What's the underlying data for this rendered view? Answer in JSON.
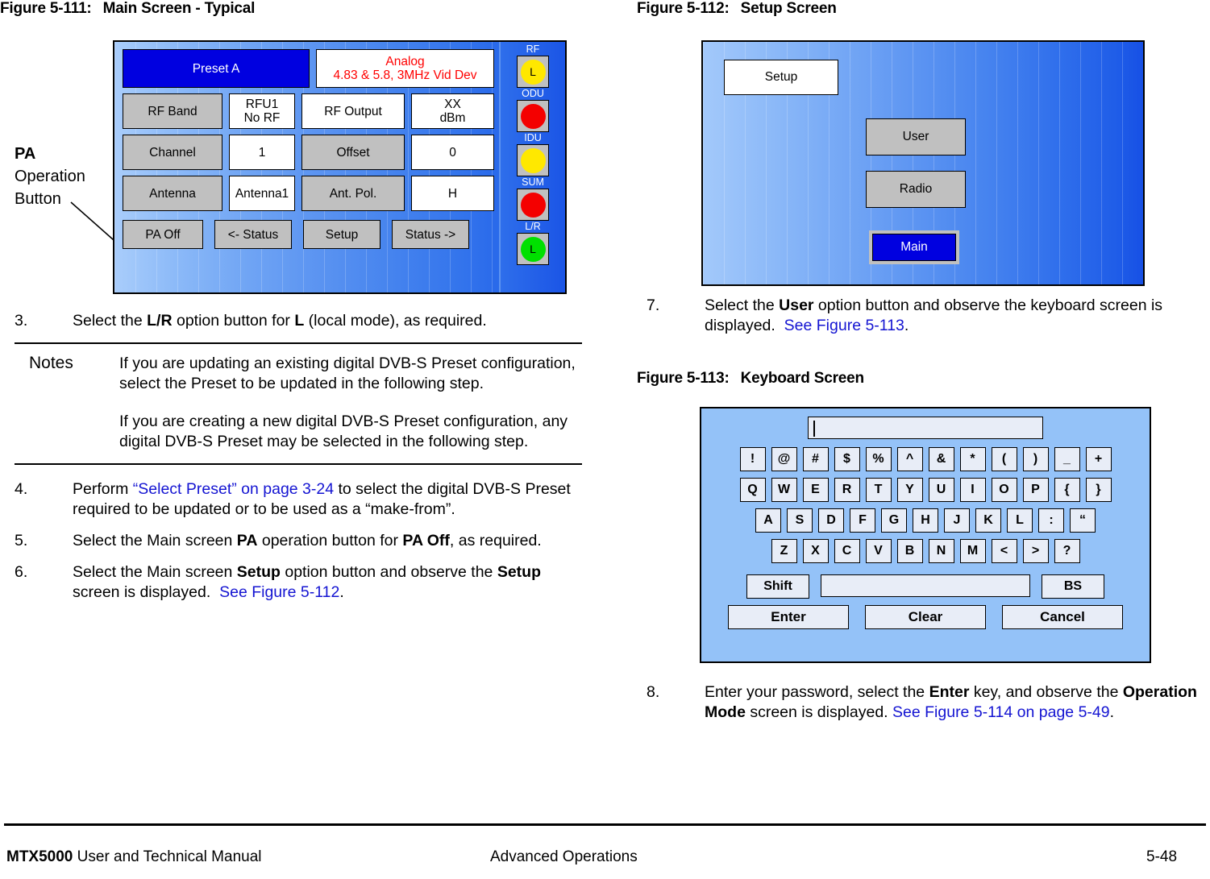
{
  "figures": {
    "fig111": {
      "num": "Figure 5-111:",
      "title": "Main Screen - Typical"
    },
    "fig112": {
      "num": "Figure 5-112:",
      "title": "Setup Screen"
    },
    "fig113": {
      "num": "Figure 5-113:",
      "title": "Keyboard Screen"
    }
  },
  "annotation": {
    "line1": "PA",
    "line2": "Operation",
    "line3": "Button"
  },
  "main_screen": {
    "preset": "Preset A",
    "mode_line1": "Analog",
    "mode_line2": "4.83 & 5.8, 3MHz Vid Dev",
    "rows": [
      {
        "label": "RF Band",
        "value_line1": "RFU1",
        "value_line2": "No RF",
        "label2": "RF Output",
        "value2_line1": "XX",
        "value2_line2": "dBm"
      },
      {
        "label": "Channel",
        "value_line1": "1",
        "value_line2": "",
        "label2": "Offset",
        "value2_line1": "0",
        "value2_line2": ""
      },
      {
        "label": "Antenna",
        "value_line1": "Antenna1",
        "value_line2": "",
        "label2": "Ant. Pol.",
        "value2_line1": "H",
        "value2_line2": ""
      }
    ],
    "bottom_buttons": [
      "PA Off",
      "<- Status",
      "Setup",
      "Status ->"
    ],
    "indicators": [
      {
        "name": "RF",
        "color": "#ffe800",
        "text": "L"
      },
      {
        "name": "ODU",
        "color": "#f40000",
        "text": ""
      },
      {
        "name": "IDU",
        "color": "#ffe800",
        "text": ""
      },
      {
        "name": "SUM",
        "color": "#f40000",
        "text": ""
      },
      {
        "name": "L/R",
        "color": "#00e000",
        "text": "L"
      }
    ]
  },
  "setup_screen": {
    "title_button": "Setup",
    "user_button": "User",
    "radio_button": "Radio",
    "main_button": "Main"
  },
  "keyboard_screen": {
    "input_value": "",
    "row_symbols": [
      "!",
      "@",
      "#",
      "$",
      "%",
      "^",
      "&",
      "*",
      "(",
      ")",
      "_",
      "+"
    ],
    "row_qwerty": [
      "Q",
      "W",
      "E",
      "R",
      "T",
      "Y",
      "U",
      "I",
      "O",
      "P",
      "{",
      "}"
    ],
    "row_asdf": [
      "A",
      "S",
      "D",
      "F",
      "G",
      "H",
      "J",
      "K",
      "L",
      ":",
      "“"
    ],
    "row_zxcv": [
      "Z",
      "X",
      "C",
      "V",
      "B",
      "N",
      "M",
      "<",
      ">",
      "?"
    ],
    "shift_key": "Shift",
    "space_key": "",
    "bs_key": "BS",
    "enter_key": "Enter",
    "clear_key": "Clear",
    "cancel_key": "Cancel"
  },
  "steps": {
    "s3": {
      "num": "3.",
      "html": "Select the <b>L/R</b> option button for <b>L</b> (local mode), as required."
    },
    "s4": {
      "num": "4.",
      "html": "Perform <span class=\"lnk\">&ldquo;Select Preset&rdquo; on page 3-24</span> to select the digital DVB-S Preset required to be updated or to be used as a &ldquo;make-from&rdquo;."
    },
    "s5": {
      "num": "5.",
      "html": "Select the Main screen <b>PA</b> operation button for <b>PA Off</b>, as required."
    },
    "s6": {
      "num": "6.",
      "html": "Select the Main screen <b>Setup</b> option button and observe the <b>Setup</b> screen is displayed.&nbsp; <span class=\"lnk\">See Figure 5-112</span>."
    },
    "s7": {
      "num": "7.",
      "html": "Select the <b>User</b> option button and observe the keyboard screen is displayed.&nbsp; <span class=\"lnk\">See Figure 5-113</span>."
    },
    "s8": {
      "num": "8.",
      "html": "Enter your password, select the <b>Enter</b> key, and observe the <b>Operation Mode</b> screen is displayed. <span class=\"lnk\">See Figure 5-114 on page 5-49</span>."
    }
  },
  "notes": {
    "label": "Notes",
    "p1": "If you are updating an existing digital DVB-S Preset configuration, select the Preset to be updated in the following step.",
    "p2": "If you are creating a new digital DVB-S Preset configuration, any digital DVB-S Preset may be selected in the following step."
  },
  "footer": {
    "left_bold": "MTX5000",
    "left_rest": " User and Technical Manual",
    "center": "Advanced Operations",
    "right": "5-48"
  }
}
